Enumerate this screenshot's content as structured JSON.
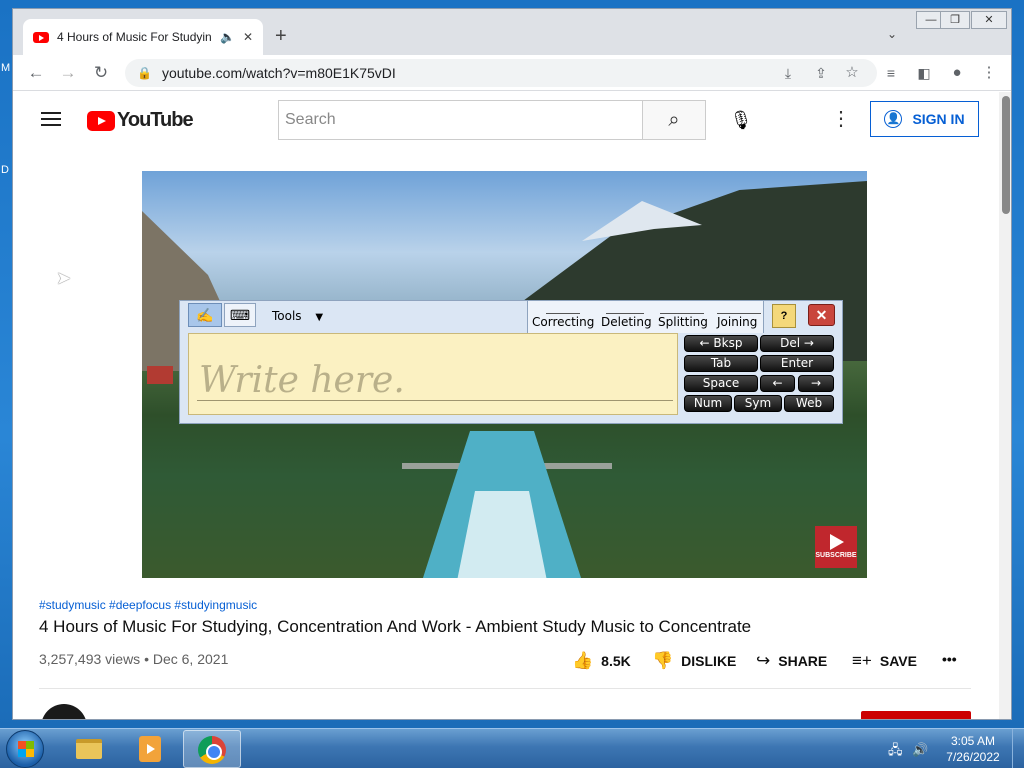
{
  "browser": {
    "tab_title": "4 Hours of Music For Studyin",
    "url": "youtube.com/watch?v=m80E1K75vDI",
    "icons": [
      "back-icon",
      "forward-icon",
      "reload-icon",
      "lock-icon",
      "install-icon",
      "share-icon",
      "star-icon",
      "media-control-icon",
      "side-panel-icon",
      "profile-icon",
      "menu-icon"
    ]
  },
  "youtube": {
    "logo_text": "YouTube",
    "search_placeholder": "Search",
    "signin_label": "SIGN IN",
    "video": {
      "hashtags": "#studymusic #deepfocus #studyingmusic",
      "title": "4 Hours of Music For Studying, Concentration And Work - Ambient Study Music to Concentrate",
      "meta": "3,257,493 views • Dec 6, 2021",
      "subscribe_overlay": "SUBSCRIBE"
    },
    "actions": {
      "like_count": "8.5K",
      "dislike": "DISLIKE",
      "share": "SHARE",
      "save": "SAVE"
    }
  },
  "input_panel": {
    "tools_label": "Tools",
    "gestures": [
      "Correcting",
      "Deleting",
      "Splitting",
      "Joining"
    ],
    "write_hint": "Write here.",
    "keys": {
      "bksp": "← Bksp",
      "del": "Del →",
      "tab": "Tab",
      "enter": "Enter",
      "space": "Space",
      "left": "←",
      "right": "→",
      "num": "Num",
      "sym": "Sym",
      "web": "Web"
    }
  },
  "taskbar": {
    "time": "3:05 AM",
    "date": "7/26/2022"
  },
  "colors": {
    "youtube_red": "#ff0000",
    "link_blue": "#065fd4",
    "taskbar_blue": "#3d76b3"
  }
}
